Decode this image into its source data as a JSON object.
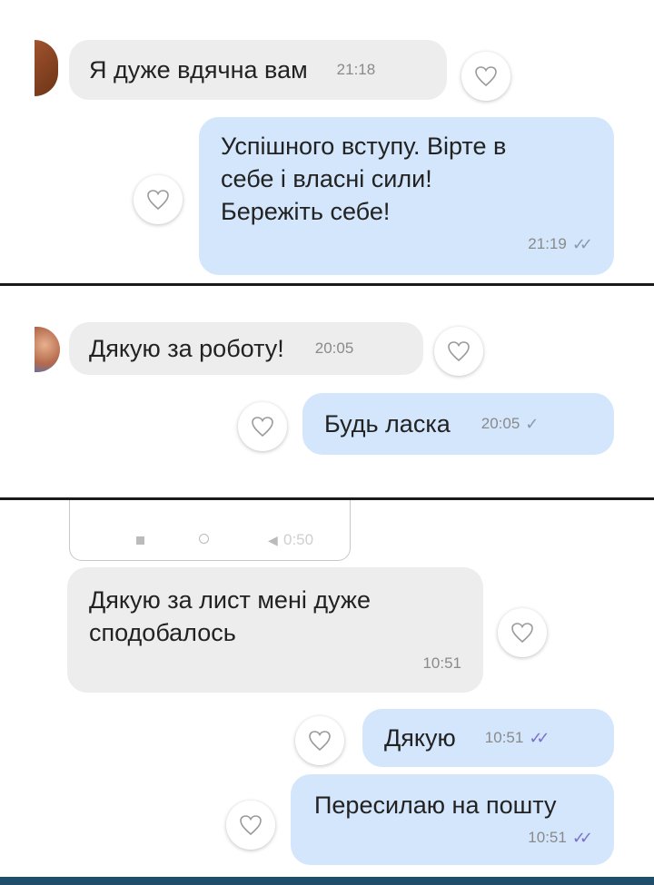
{
  "screenshot_1": {
    "incoming": {
      "text": "Я дуже вдячна вам",
      "time": "21:18"
    },
    "outgoing": {
      "lines": [
        "Успішного вступу. Вірте в",
        "себе і власні сили!",
        "Бережіть себе!"
      ],
      "time": "21:19",
      "status": "read"
    }
  },
  "screenshot_2": {
    "incoming": {
      "text": "Дякую за роботу!",
      "time": "20:05"
    },
    "outgoing": {
      "text": "Будь ласка",
      "time": "20:05",
      "status": "sent"
    }
  },
  "screenshot_3": {
    "media_player": {
      "time": "0:50"
    },
    "incoming": {
      "lines": [
        "Дякую за лист мені дуже",
        "сподобалось"
      ],
      "time": "10:51"
    },
    "outgoing": [
      {
        "text": "Дякую",
        "time": "10:51",
        "status": "read"
      },
      {
        "text": "Пересилаю на пошту",
        "time": "10:51",
        "status": "read"
      }
    ]
  },
  "icons": {
    "heart": "heart-outline-icon",
    "check_read": "double-check-icon",
    "check_sent": "single-check-icon"
  },
  "colors": {
    "incoming_bubble": "#ededed",
    "outgoing_bubble": "#d3e6fb",
    "read_check": "#7c6fd0"
  }
}
